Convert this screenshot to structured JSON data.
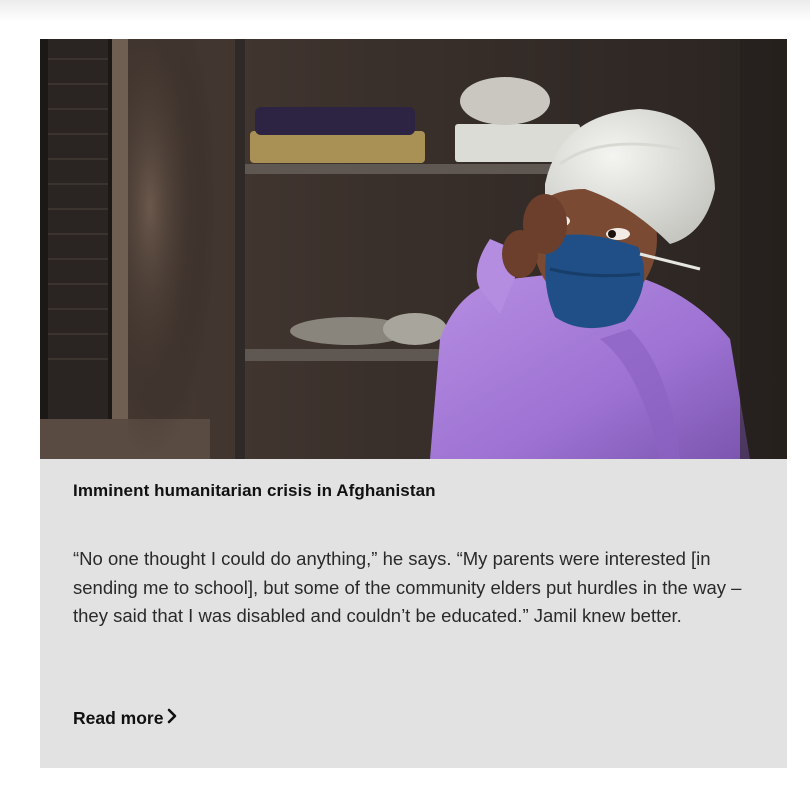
{
  "article": {
    "image_alt": "Health worker in a purple gown and hair net putting on a blue face mask",
    "title": "Imminent humanitarian crisis in Afghanistan",
    "excerpt": "“No one thought I could do anything,” he says. “My parents were interested [in sending me to school], but some of the community elders put hurdles in the way – they said that I was disabled and couldn’t be educated.” Jamil knew better.",
    "read_more_label": "Read more",
    "read_more_icon": "chevron-right-icon"
  },
  "colors": {
    "card_background": "#e2e2e2",
    "text_primary": "#111111",
    "gown_purple": "#a77bd8",
    "mask_blue": "#1f4f86"
  }
}
